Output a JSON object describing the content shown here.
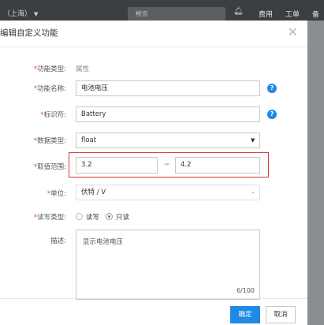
{
  "topbar": {
    "region_label": "（上海）",
    "search_placeholder": "搜索",
    "nav_items": [
      "费用",
      "工单",
      "备案"
    ]
  },
  "dialog": {
    "title": "编辑自定义功能",
    "fields": {
      "function_type": {
        "label": "功能类型:",
        "value": "属性"
      },
      "function_name": {
        "label": "功能名称:",
        "value": "电池电压"
      },
      "identifier": {
        "label": "标识符:",
        "value": "Battery"
      },
      "data_type": {
        "label": "数据类型:",
        "value": "float"
      },
      "value_range": {
        "label": "取值范围:",
        "min": "3.2",
        "separator": "~",
        "max": "4.2"
      },
      "unit": {
        "label": "单位:",
        "value": "伏特 / V"
      },
      "rw_type": {
        "label": "读写类型:",
        "options": [
          "读写",
          "只读"
        ],
        "selected": "只读"
      },
      "description": {
        "label": "描述:",
        "value": "显示电池电压",
        "counter": "6/100"
      }
    },
    "buttons": {
      "ok": "确定",
      "cancel": "取消"
    }
  },
  "colors": {
    "primary": "#1e8ae6",
    "required": "#e5413a",
    "highlight": "#d9343a"
  }
}
